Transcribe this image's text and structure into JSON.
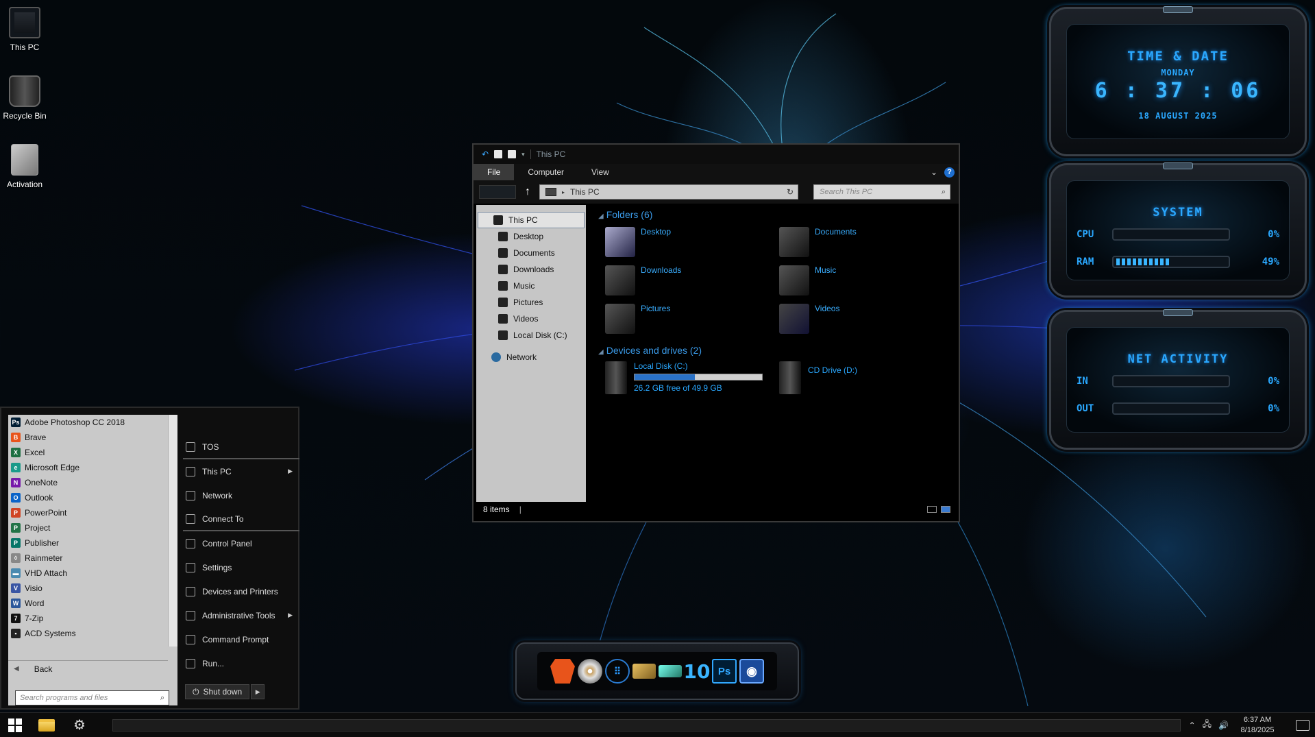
{
  "desktop_icons": [
    {
      "label": "This PC",
      "icon": "computer-icon"
    },
    {
      "label": "Recycle Bin",
      "icon": "recycle-bin-icon"
    },
    {
      "label": "Activation",
      "icon": "activation-icon"
    }
  ],
  "explorer": {
    "title": "This PC",
    "ribbon_tabs": [
      "File",
      "Computer",
      "View"
    ],
    "address": "This PC",
    "search_placeholder": "Search This PC",
    "nav": {
      "selected": "This PC",
      "items": [
        "Desktop",
        "Documents",
        "Downloads",
        "Music",
        "Pictures",
        "Videos",
        "Local Disk (C:)"
      ],
      "network": "Network"
    },
    "folders_header": "Folders (6)",
    "folders": [
      "Desktop",
      "Documents",
      "Downloads",
      "Music",
      "Pictures",
      "Videos"
    ],
    "drives_header": "Devices and drives (2)",
    "drives": [
      {
        "name": "Local Disk (C:)",
        "free_text": "26.2 GB free of 49.9 GB",
        "used_fraction": 0.475
      },
      {
        "name": "CD Drive (D:)"
      }
    ],
    "status": "8 items"
  },
  "start_menu": {
    "programs": [
      {
        "label": "Adobe Photoshop CC 2018",
        "icon": "photoshop-icon",
        "color": "#001d34",
        "glyph": "Ps"
      },
      {
        "label": "Brave",
        "icon": "brave-icon",
        "color": "#e8541b",
        "glyph": "B"
      },
      {
        "label": "Excel",
        "icon": "excel-icon",
        "color": "#1d6f42",
        "glyph": "X"
      },
      {
        "label": "Microsoft Edge",
        "icon": "edge-icon",
        "color": "#1a9a8a",
        "glyph": "e"
      },
      {
        "label": "OneNote",
        "icon": "onenote-icon",
        "color": "#7719aa",
        "glyph": "N"
      },
      {
        "label": "Outlook",
        "icon": "outlook-icon",
        "color": "#0a64c8",
        "glyph": "O"
      },
      {
        "label": "PowerPoint",
        "icon": "powerpoint-icon",
        "color": "#d04423",
        "glyph": "P"
      },
      {
        "label": "Project",
        "icon": "project-icon",
        "color": "#217346",
        "glyph": "P"
      },
      {
        "label": "Publisher",
        "icon": "publisher-icon",
        "color": "#077568",
        "glyph": "P"
      },
      {
        "label": "Rainmeter",
        "icon": "rainmeter-icon",
        "color": "#888888",
        "glyph": "◊"
      },
      {
        "label": "VHD Attach",
        "icon": "vhd-attach-icon",
        "color": "#4a8ab0",
        "glyph": "▬"
      },
      {
        "label": "Visio",
        "icon": "visio-icon",
        "color": "#3955a3",
        "glyph": "V"
      },
      {
        "label": "Word",
        "icon": "word-icon",
        "color": "#2b579a",
        "glyph": "W"
      },
      {
        "label": "7-Zip",
        "icon": "7zip-icon",
        "color": "#111111",
        "glyph": "7"
      },
      {
        "label": "ACD Systems",
        "icon": "folder-icon",
        "color": "#222222",
        "glyph": "▪"
      }
    ],
    "back_label": "Back",
    "search_placeholder": "Search programs and files",
    "places": [
      {
        "label": "TOS",
        "icon": "user-icon",
        "submenu": false,
        "separator": true
      },
      {
        "label": "This PC",
        "icon": "computer-icon",
        "submenu": true,
        "separator": false
      },
      {
        "label": "Network",
        "icon": "network-icon",
        "submenu": false,
        "separator": false
      },
      {
        "label": "Connect To",
        "icon": "connect-icon",
        "submenu": false,
        "separator": true
      },
      {
        "label": "Control Panel",
        "icon": "control-panel-icon",
        "submenu": false,
        "separator": false
      },
      {
        "label": "Settings",
        "icon": "gear-icon",
        "submenu": false,
        "separator": false
      },
      {
        "label": "Devices and Printers",
        "icon": "printer-icon",
        "submenu": false,
        "separator": false
      },
      {
        "label": "Administrative Tools",
        "icon": "admin-tools-icon",
        "submenu": true,
        "separator": false
      },
      {
        "label": "Command Prompt",
        "icon": "cmd-icon",
        "submenu": false,
        "separator": false
      },
      {
        "label": "Run...",
        "icon": "run-icon",
        "submenu": false,
        "separator": false
      }
    ],
    "shutdown_label": "Shut down"
  },
  "dock": [
    "brave-icon",
    "dvd-icon",
    "dots-app-icon",
    "package-icon",
    "drive-icon",
    "windows-10-icon",
    "photoshop-icon",
    "camera-icon"
  ],
  "dock_glyphs": {
    "ten": "10",
    "ps": "Ps",
    "dots": "⠿",
    "cam": "◉"
  },
  "widgets": {
    "time": {
      "title": "TIME & DATE",
      "day": "MONDAY",
      "clock": "6 : 37 : 06",
      "date": "18 AUGUST 2025"
    },
    "system": {
      "title": "SYSTEM",
      "cpu_label": "CPU",
      "cpu_pct": "0%",
      "cpu_value": 0,
      "ram_label": "RAM",
      "ram_pct": "49%",
      "ram_value": 0.49
    },
    "net": {
      "title": "NET ACTIVITY",
      "in_label": "IN",
      "in_pct": "0%",
      "in_value": 0,
      "out_label": "OUT",
      "out_pct": "0%",
      "out_value": 0
    }
  },
  "taskbar": {
    "time": "6:37 AM",
    "date": "8/18/2025"
  },
  "colors": {
    "accent": "#2aa8ff",
    "brand_blue": "#1e6fd0"
  }
}
